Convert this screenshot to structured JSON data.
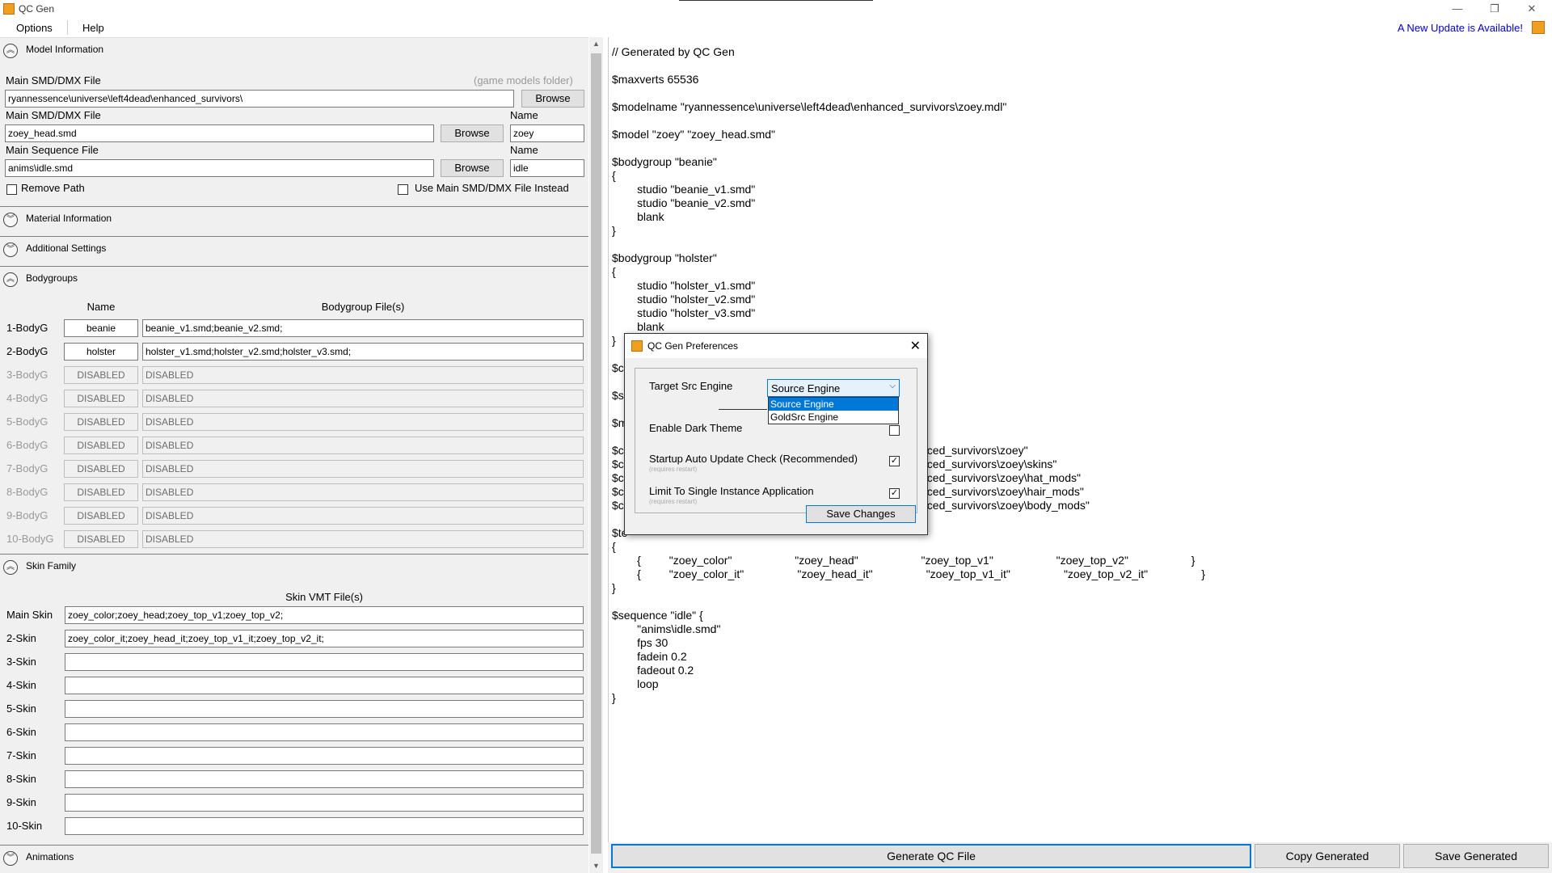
{
  "window": {
    "title": "QC Gen",
    "minimize": "—",
    "restore": "❐",
    "close": "✕"
  },
  "menu": {
    "options": "Options",
    "help": "Help",
    "update_link": "A New Update is Available!"
  },
  "model_info": {
    "header": "Model Information",
    "main_file_label": "Main SMD/DMX File",
    "game_models_hint": "(game models folder)",
    "models_path": "ryannessence\\universe\\left4dead\\enhanced_survivors\\",
    "browse": "Browse",
    "smd_label": "Main SMD/DMX File",
    "smd_value": "zoey_head.smd",
    "name_label": "Name",
    "smd_name": "zoey",
    "seq_label": "Main Sequence File",
    "seq_value": "anims\\idle.smd",
    "seq_name": "idle",
    "remove_path": "Remove Path",
    "use_main": "Use Main SMD/DMX File Instead"
  },
  "sections": {
    "material": "Material Information",
    "additional": "Additional Settings",
    "bodygroups": "Bodygroups",
    "skin_family": "Skin Family",
    "animations": "Animations"
  },
  "bodygroups": {
    "col_name": "Name",
    "col_files": "Bodygroup File(s)",
    "rows": [
      {
        "label": "1-BodyG",
        "name": "beanie",
        "files": "beanie_v1.smd;beanie_v2.smd;"
      },
      {
        "label": "2-BodyG",
        "name": "holster",
        "files": "holster_v1.smd;holster_v2.smd;holster_v3.smd;"
      },
      {
        "label": "3-BodyG",
        "name": "DISABLED",
        "files": "DISABLED"
      },
      {
        "label": "4-BodyG",
        "name": "DISABLED",
        "files": "DISABLED"
      },
      {
        "label": "5-BodyG",
        "name": "DISABLED",
        "files": "DISABLED"
      },
      {
        "label": "6-BodyG",
        "name": "DISABLED",
        "files": "DISABLED"
      },
      {
        "label": "7-BodyG",
        "name": "DISABLED",
        "files": "DISABLED"
      },
      {
        "label": "8-BodyG",
        "name": "DISABLED",
        "files": "DISABLED"
      },
      {
        "label": "9-BodyG",
        "name": "DISABLED",
        "files": "DISABLED"
      },
      {
        "label": "10-BodyG",
        "name": "DISABLED",
        "files": "DISABLED"
      }
    ]
  },
  "skins": {
    "col_files": "Skin VMT File(s)",
    "rows": [
      {
        "label": "Main Skin",
        "files": "zoey_color;zoey_head;zoey_top_v1;zoey_top_v2;"
      },
      {
        "label": "2-Skin",
        "files": "zoey_color_it;zoey_head_it;zoey_top_v1_it;zoey_top_v2_it;"
      },
      {
        "label": "3-Skin",
        "files": ""
      },
      {
        "label": "4-Skin",
        "files": ""
      },
      {
        "label": "5-Skin",
        "files": ""
      },
      {
        "label": "6-Skin",
        "files": ""
      },
      {
        "label": "7-Skin",
        "files": ""
      },
      {
        "label": "8-Skin",
        "files": ""
      },
      {
        "label": "9-Skin",
        "files": ""
      },
      {
        "label": "10-Skin",
        "files": ""
      }
    ]
  },
  "editor": {
    "lines": [
      {
        "t": "// Generated by QC Gen"
      },
      {
        "t": "$maxverts 65536"
      },
      {
        "t": "$modelname \"ryannessence\\universe\\left4dead\\enhanced_survivors\\zoey.mdl\""
      },
      {
        "t": "$model \"zoey\" \"zoey_head.smd\""
      },
      {
        "t": "$bodygroup \"beanie\""
      },
      {
        "t": "{"
      },
      {
        "t": "        studio \"beanie_v1.smd\""
      },
      {
        "t": "        studio \"beanie_v2.smd\""
      },
      {
        "t": "        blank"
      },
      {
        "t": "}"
      },
      {
        "t": "$bodygroup \"holster\""
      },
      {
        "t": "{"
      },
      {
        "t": "        studio \"holster_v1.smd\""
      },
      {
        "t": "        studio \"holster_v2.smd\""
      },
      {
        "t": "        studio \"holster_v3.smd\""
      },
      {
        "t": "        blank"
      },
      {
        "t": "}"
      },
      {
        "t": "$c"
      },
      {
        "t": "$s"
      },
      {
        "t": "$m"
      },
      {
        "t": "$c"
      },
      {
        "t": "$c"
      },
      {
        "t": "$c"
      },
      {
        "t": "$c"
      },
      {
        "t": "$c"
      },
      {
        "t": "$te"
      },
      {
        "t": "{"
      },
      {
        "t": "        {         \"zoey_color\"                    \"zoey_head\"                    \"zoey_top_v1\"                    \"zoey_top_v2\"                    }"
      },
      {
        "t": "        {         \"zoey_color_it\"                 \"zoey_head_it\"                 \"zoey_top_v1_it\"                 \"zoey_top_v2_it\"                 }"
      },
      {
        "t": "}"
      },
      {
        "t": "$sequence \"idle\" {"
      },
      {
        "t": "        \"anims\\idle.smd\""
      },
      {
        "t": "        fps 30"
      },
      {
        "t": "        fadein 0.2"
      },
      {
        "t": "        fadeout 0.2"
      },
      {
        "t": "        loop"
      },
      {
        "t": "}"
      }
    ],
    "partial_right": [
      "nced_survivors\\zoey\"",
      "nced_survivors\\zoey\\skins\"",
      "nced_survivors\\zoey\\hat_mods\"",
      "nced_survivors\\zoey\\hair_mods\"",
      "nced_survivors\\zoey\\body_mods\""
    ]
  },
  "bottom": {
    "generate": "Generate QC File",
    "copy": "Copy Generated",
    "save": "Save Generated"
  },
  "dialog": {
    "title": "QC Gen Preferences",
    "close": "✕",
    "target_engine_label": "Target Src Engine",
    "engine_selected": "Source Engine",
    "engine_options": [
      "Source Engine",
      "GoldSrc Engine"
    ],
    "dark_theme": "Enable Dark Theme",
    "auto_update": "Startup Auto Update Check (Recommended)",
    "requires_restart": "(requires restart)",
    "single_instance": "Limit To Single Instance Application",
    "save": "Save Changes",
    "check_mark": "✓"
  }
}
